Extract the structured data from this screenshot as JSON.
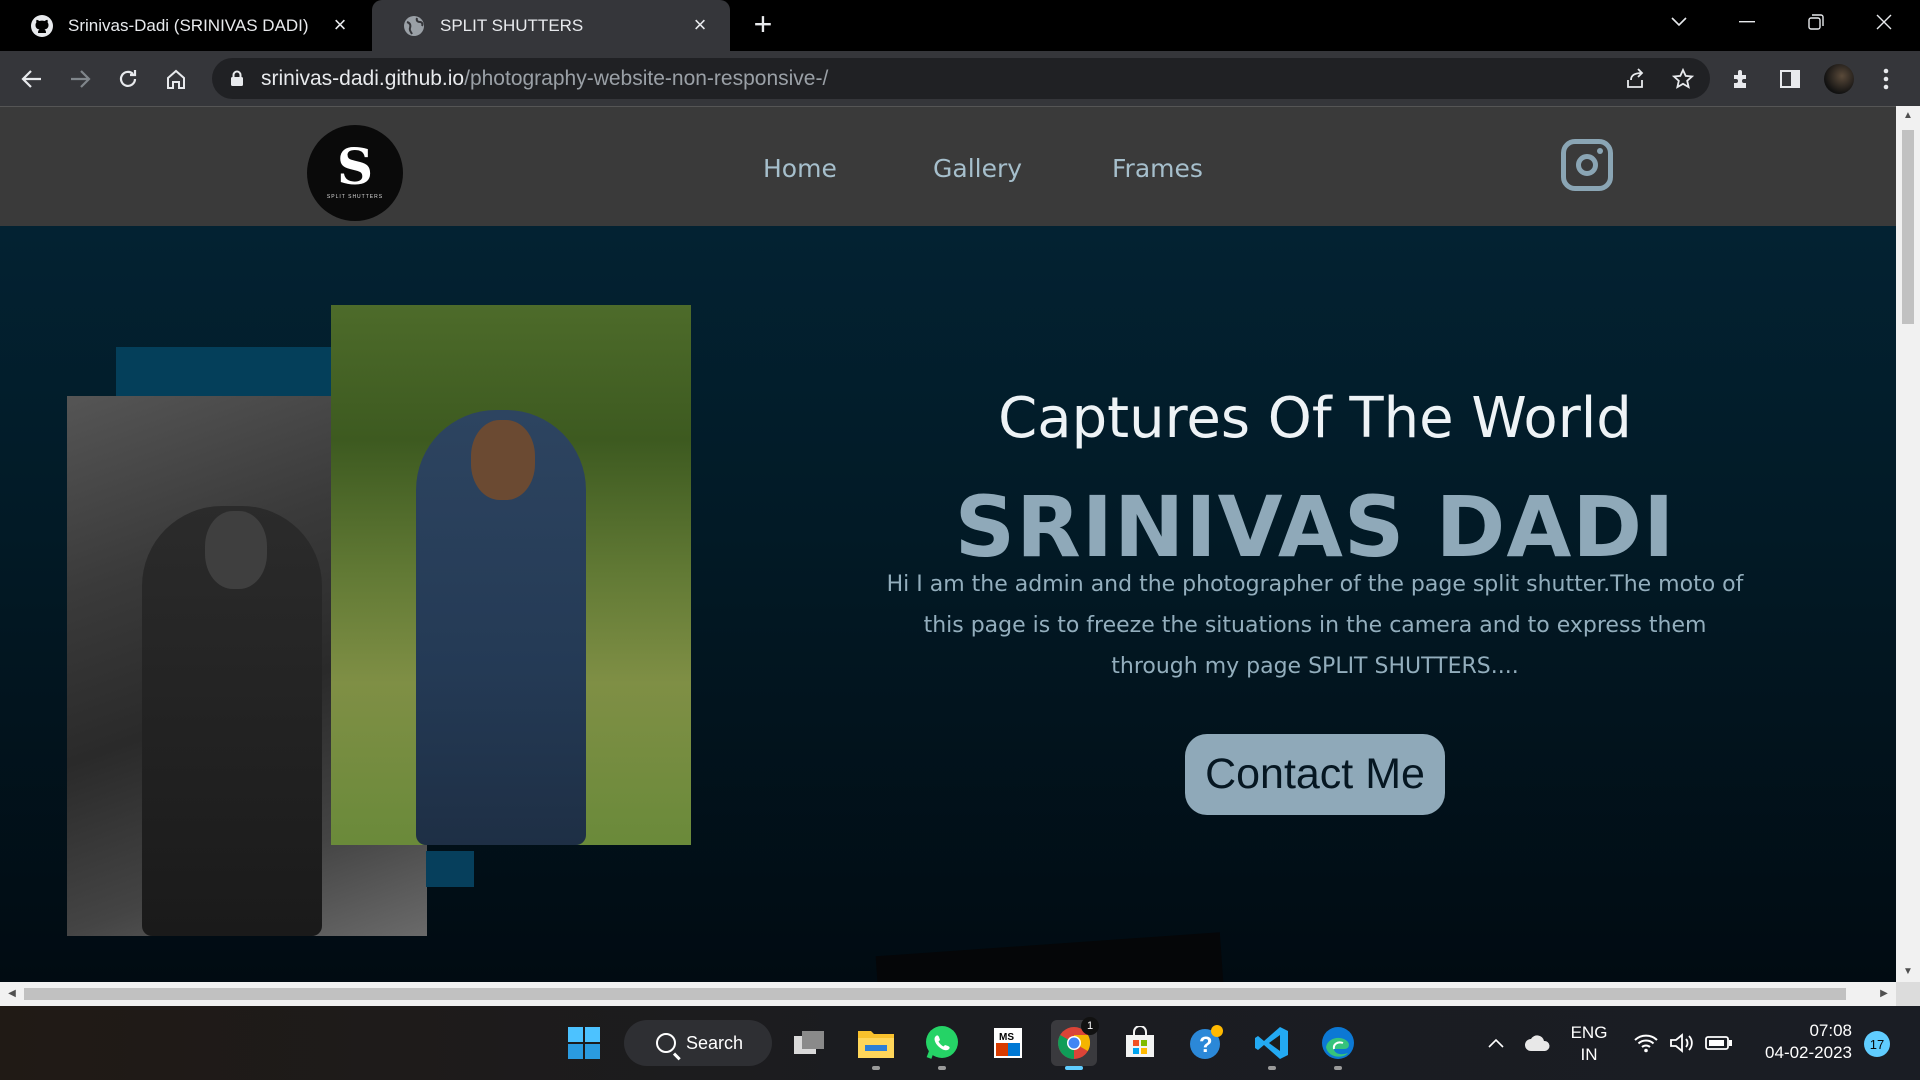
{
  "browser": {
    "tabs": [
      {
        "title": "Srinivas-Dadi (SRINIVAS DADI)",
        "icon": "github-icon",
        "active": false
      },
      {
        "title": "SPLIT SHUTTERS",
        "icon": "globe-icon",
        "active": true
      }
    ],
    "url_host": "srinivas-dadi.github.io",
    "url_path": "/photography-website-non-responsive-/"
  },
  "site": {
    "logo_mark": "S",
    "logo_text": "SPLIT SHUTTERS",
    "nav": {
      "home": "Home",
      "gallery": "Gallery",
      "frames": "Frames"
    },
    "hero": {
      "subtitle": "Captures Of The World",
      "title": "SRINIVAS DADI",
      "body": "Hi I am the admin and the photographer of the page split shutter.The moto of this page is to freeze the situations in the camera and to express them through my page SPLIT SHUTTERS....",
      "contact_label": "Contact Me"
    },
    "colors": {
      "accent": "#8fa9b9",
      "background": "#031820",
      "nav_bg": "#3a3a3a"
    }
  },
  "taskbar": {
    "search_label": "Search",
    "language_line1": "ENG",
    "language_line2": "IN",
    "time": "07:08",
    "date": "04-02-2023",
    "notification_count": "17",
    "chrome_badge": "1"
  }
}
